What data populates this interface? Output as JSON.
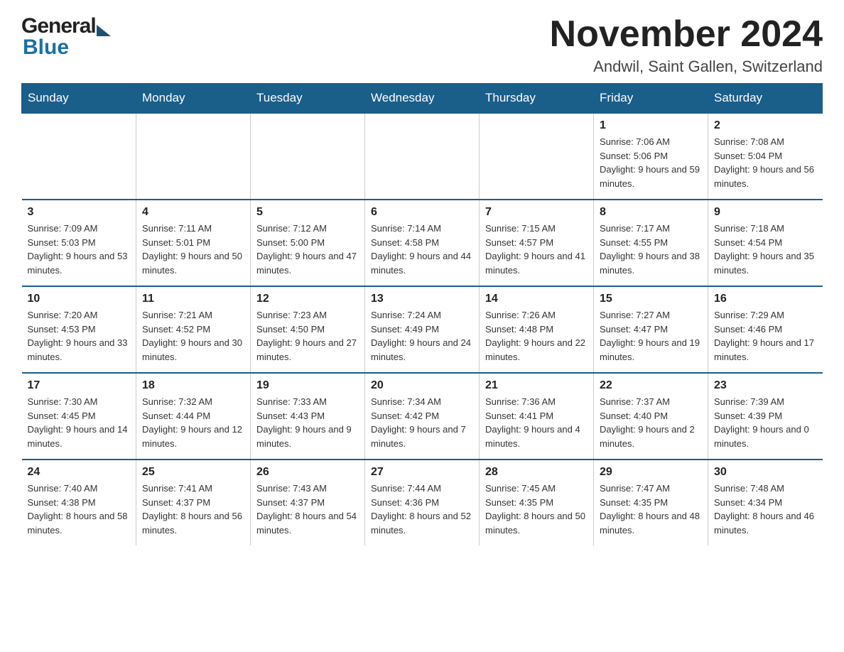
{
  "logo": {
    "general": "General",
    "triangle": "▶",
    "blue": "Blue"
  },
  "header": {
    "month_title": "November 2024",
    "location": "Andwil, Saint Gallen, Switzerland"
  },
  "weekdays": [
    "Sunday",
    "Monday",
    "Tuesday",
    "Wednesday",
    "Thursday",
    "Friday",
    "Saturday"
  ],
  "weeks": [
    [
      {
        "day": "",
        "info": ""
      },
      {
        "day": "",
        "info": ""
      },
      {
        "day": "",
        "info": ""
      },
      {
        "day": "",
        "info": ""
      },
      {
        "day": "",
        "info": ""
      },
      {
        "day": "1",
        "info": "Sunrise: 7:06 AM\nSunset: 5:06 PM\nDaylight: 9 hours and 59 minutes."
      },
      {
        "day": "2",
        "info": "Sunrise: 7:08 AM\nSunset: 5:04 PM\nDaylight: 9 hours and 56 minutes."
      }
    ],
    [
      {
        "day": "3",
        "info": "Sunrise: 7:09 AM\nSunset: 5:03 PM\nDaylight: 9 hours and 53 minutes."
      },
      {
        "day": "4",
        "info": "Sunrise: 7:11 AM\nSunset: 5:01 PM\nDaylight: 9 hours and 50 minutes."
      },
      {
        "day": "5",
        "info": "Sunrise: 7:12 AM\nSunset: 5:00 PM\nDaylight: 9 hours and 47 minutes."
      },
      {
        "day": "6",
        "info": "Sunrise: 7:14 AM\nSunset: 4:58 PM\nDaylight: 9 hours and 44 minutes."
      },
      {
        "day": "7",
        "info": "Sunrise: 7:15 AM\nSunset: 4:57 PM\nDaylight: 9 hours and 41 minutes."
      },
      {
        "day": "8",
        "info": "Sunrise: 7:17 AM\nSunset: 4:55 PM\nDaylight: 9 hours and 38 minutes."
      },
      {
        "day": "9",
        "info": "Sunrise: 7:18 AM\nSunset: 4:54 PM\nDaylight: 9 hours and 35 minutes."
      }
    ],
    [
      {
        "day": "10",
        "info": "Sunrise: 7:20 AM\nSunset: 4:53 PM\nDaylight: 9 hours and 33 minutes."
      },
      {
        "day": "11",
        "info": "Sunrise: 7:21 AM\nSunset: 4:52 PM\nDaylight: 9 hours and 30 minutes."
      },
      {
        "day": "12",
        "info": "Sunrise: 7:23 AM\nSunset: 4:50 PM\nDaylight: 9 hours and 27 minutes."
      },
      {
        "day": "13",
        "info": "Sunrise: 7:24 AM\nSunset: 4:49 PM\nDaylight: 9 hours and 24 minutes."
      },
      {
        "day": "14",
        "info": "Sunrise: 7:26 AM\nSunset: 4:48 PM\nDaylight: 9 hours and 22 minutes."
      },
      {
        "day": "15",
        "info": "Sunrise: 7:27 AM\nSunset: 4:47 PM\nDaylight: 9 hours and 19 minutes."
      },
      {
        "day": "16",
        "info": "Sunrise: 7:29 AM\nSunset: 4:46 PM\nDaylight: 9 hours and 17 minutes."
      }
    ],
    [
      {
        "day": "17",
        "info": "Sunrise: 7:30 AM\nSunset: 4:45 PM\nDaylight: 9 hours and 14 minutes."
      },
      {
        "day": "18",
        "info": "Sunrise: 7:32 AM\nSunset: 4:44 PM\nDaylight: 9 hours and 12 minutes."
      },
      {
        "day": "19",
        "info": "Sunrise: 7:33 AM\nSunset: 4:43 PM\nDaylight: 9 hours and 9 minutes."
      },
      {
        "day": "20",
        "info": "Sunrise: 7:34 AM\nSunset: 4:42 PM\nDaylight: 9 hours and 7 minutes."
      },
      {
        "day": "21",
        "info": "Sunrise: 7:36 AM\nSunset: 4:41 PM\nDaylight: 9 hours and 4 minutes."
      },
      {
        "day": "22",
        "info": "Sunrise: 7:37 AM\nSunset: 4:40 PM\nDaylight: 9 hours and 2 minutes."
      },
      {
        "day": "23",
        "info": "Sunrise: 7:39 AM\nSunset: 4:39 PM\nDaylight: 9 hours and 0 minutes."
      }
    ],
    [
      {
        "day": "24",
        "info": "Sunrise: 7:40 AM\nSunset: 4:38 PM\nDaylight: 8 hours and 58 minutes."
      },
      {
        "day": "25",
        "info": "Sunrise: 7:41 AM\nSunset: 4:37 PM\nDaylight: 8 hours and 56 minutes."
      },
      {
        "day": "26",
        "info": "Sunrise: 7:43 AM\nSunset: 4:37 PM\nDaylight: 8 hours and 54 minutes."
      },
      {
        "day": "27",
        "info": "Sunrise: 7:44 AM\nSunset: 4:36 PM\nDaylight: 8 hours and 52 minutes."
      },
      {
        "day": "28",
        "info": "Sunrise: 7:45 AM\nSunset: 4:35 PM\nDaylight: 8 hours and 50 minutes."
      },
      {
        "day": "29",
        "info": "Sunrise: 7:47 AM\nSunset: 4:35 PM\nDaylight: 8 hours and 48 minutes."
      },
      {
        "day": "30",
        "info": "Sunrise: 7:48 AM\nSunset: 4:34 PM\nDaylight: 8 hours and 46 minutes."
      }
    ]
  ]
}
